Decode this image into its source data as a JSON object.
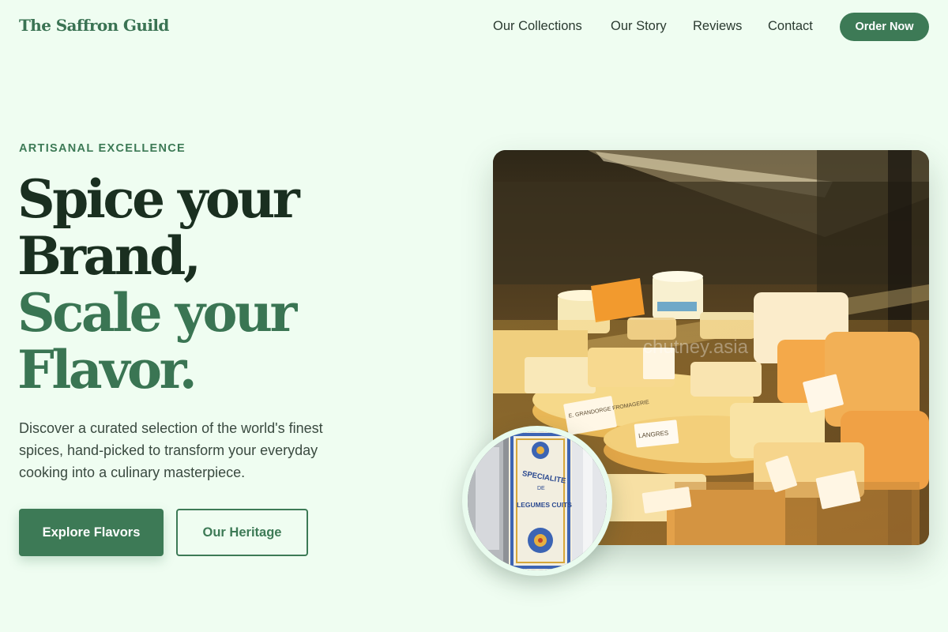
{
  "brand": {
    "name": "The Saffron Guild"
  },
  "nav": {
    "links": [
      "Our Collections",
      "Our Story",
      "Reviews",
      "Contact"
    ],
    "cta_label": "Order Now"
  },
  "hero": {
    "eyebrow": "ARTISANAL EXCELLENCE",
    "headline_line1": "Spice your",
    "headline_line2": "Brand,",
    "headline_line3": "Scale your",
    "headline_line4": "Flavor.",
    "description": "Discover a curated selection of the world's finest spices, hand-picked to transform your everyday cooking into a culinary masterpiece.",
    "primary_button": "Explore Flavors",
    "secondary_button": "Our Heritage",
    "image_watermark": "chutney.asia",
    "image_labels": [
      "E. GRANDORGE FROMAGERIE",
      "LANGRES"
    ],
    "sign_text": [
      "SPECIALITE",
      "DE",
      "LEGUMES CUITS"
    ]
  },
  "colors": {
    "background": "#effdf1",
    "brand_green": "#3d7a56",
    "headline_dark": "#1a2f20"
  }
}
